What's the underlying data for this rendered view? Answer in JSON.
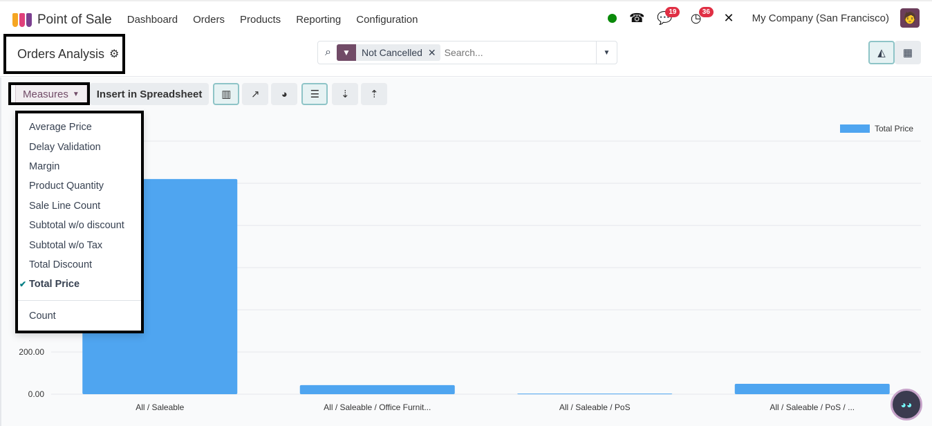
{
  "nav": {
    "app": "Point of Sale",
    "menus": [
      "Dashboard",
      "Orders",
      "Products",
      "Reporting",
      "Configuration"
    ],
    "messages_count": "19",
    "activities_count": "36",
    "company": "My Company (San Francisco)"
  },
  "page": {
    "title": "Orders Analysis"
  },
  "search": {
    "facet": "Not Cancelled",
    "placeholder": "Search..."
  },
  "toolbar": {
    "measures": "Measures",
    "insert": "Insert in Spreadsheet"
  },
  "measures_menu": {
    "items": [
      "Average Price",
      "Delay Validation",
      "Margin",
      "Product Quantity",
      "Sale Line Count",
      "Subtotal w/o discount",
      "Subtotal w/o Tax",
      "Total Discount",
      "Total Price"
    ],
    "selected": "Total Price",
    "count": "Count"
  },
  "colors": {
    "bar": "#4fa5f0",
    "brand": "#714b67",
    "accent": "#017e84"
  },
  "chart_data": {
    "type": "bar",
    "categories": [
      "All / Saleable",
      "All / Saleable / Office Furnit...",
      "All / Saleable / PoS",
      "All / Saleable / PoS / ..."
    ],
    "series": [
      {
        "name": "Total Price",
        "values": [
          1020,
          43,
          3,
          49
        ]
      }
    ],
    "yticks": [
      "0.00",
      "200.00"
    ],
    "ylim": [
      0,
      1200
    ],
    "legend": "top-right",
    "grid": true
  }
}
